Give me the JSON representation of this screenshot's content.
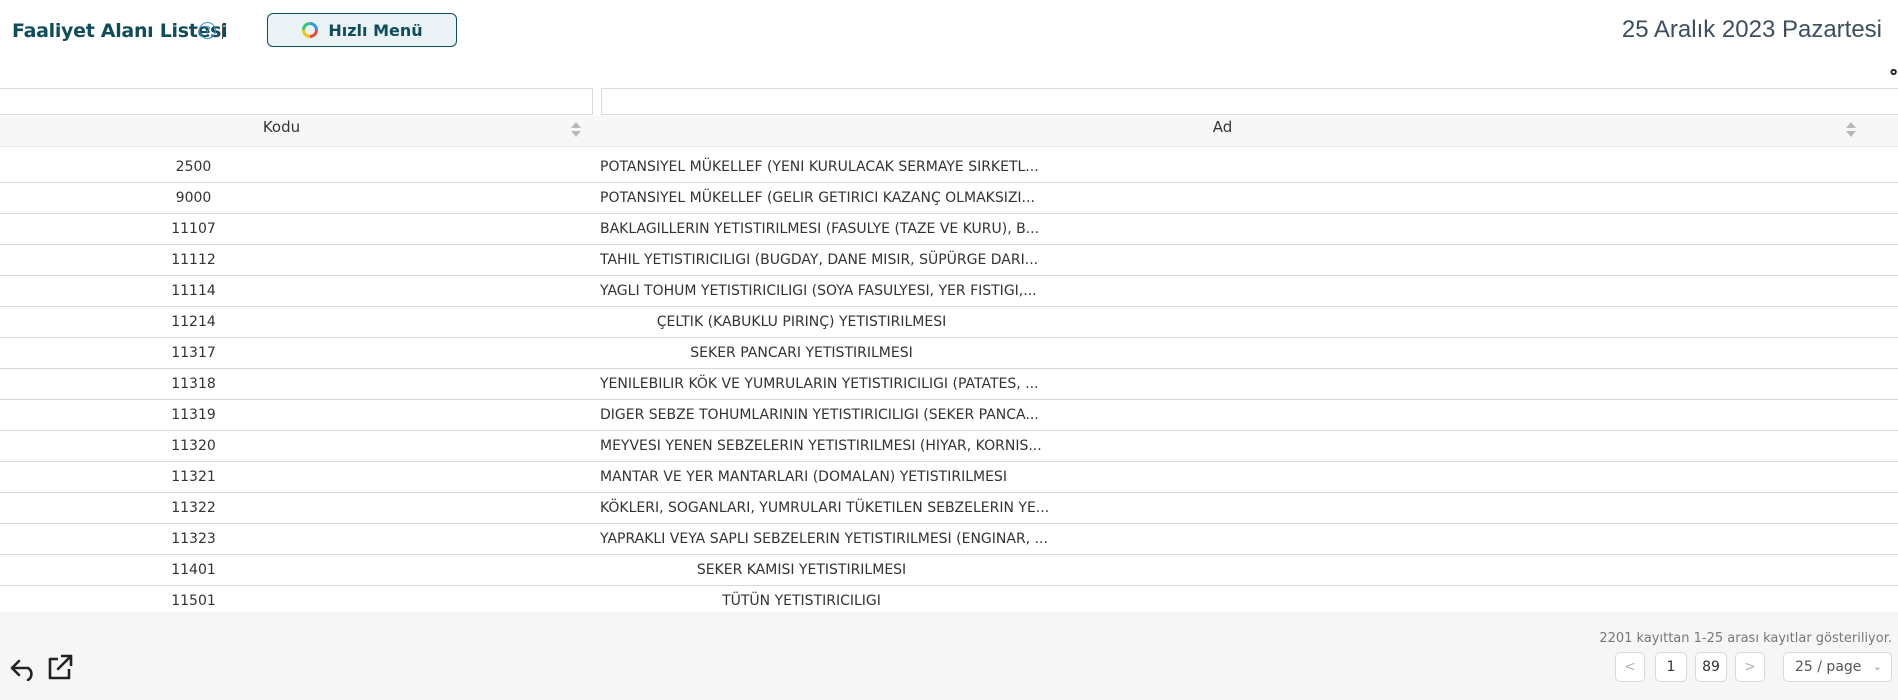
{
  "header": {
    "title": "Faaliyet Alanı Listesi",
    "help_icon": "?",
    "quick_menu_label": "Hızlı Menü",
    "date": "25 Aralık 2023 Pazartesi"
  },
  "table": {
    "columns": [
      {
        "key": "code",
        "label": "Kodu"
      },
      {
        "key": "name",
        "label": "Ad"
      }
    ],
    "rows": [
      {
        "code": "2500",
        "name": "POTANSIYEL MÜKELLEF (YENI KURULACAK SERMAYE SIRKETL..."
      },
      {
        "code": "9000",
        "name": "POTANSIYEL MÜKELLEF (GELIR GETIRICI KAZANÇ OLMAKSIZI..."
      },
      {
        "code": "11107",
        "name": "BAKLAGILLERIN YETISTIRILMESI (FASULYE (TAZE VE KURU), B..."
      },
      {
        "code": "11112",
        "name": "TAHIL YETISTIRICILIGI (BUGDAY, DANE MISIR, SÜPÜRGE DARI..."
      },
      {
        "code": "11114",
        "name": "YAGLI TOHUM YETISTIRICILIGI (SOYA FASULYESI, YER FISTIGI,..."
      },
      {
        "code": "11214",
        "name": "ÇELTIK (KABUKLU PIRINÇ) YETISTIRILMESI"
      },
      {
        "code": "11317",
        "name": "SEKER PANCARI YETISTIRILMESI"
      },
      {
        "code": "11318",
        "name": "YENILEBILIR KÖK VE YUMRULARIN YETISTIRICILIGI (PATATES, ..."
      },
      {
        "code": "11319",
        "name": "DIGER SEBZE TOHUMLARININ YETISTIRICILIGI (SEKER PANCA..."
      },
      {
        "code": "11320",
        "name": "MEYVESI YENEN SEBZELERIN YETISTIRILMESI (HIYAR, KORNIS..."
      },
      {
        "code": "11321",
        "name": "MANTAR VE YER MANTARLARI (DOMALAN) YETISTIRILMESI"
      },
      {
        "code": "11322",
        "name": "KÖKLERI, SOGANLARI, YUMRULARI TÜKETILEN SEBZELERIN YE..."
      },
      {
        "code": "11323",
        "name": "YAPRAKLI VEYA SAPLI SEBZELERIN YETISTIRILMESI (ENGINAR, ..."
      },
      {
        "code": "11401",
        "name": "SEKER KAMISI YETISTIRILMESI"
      },
      {
        "code": "11501",
        "name": "TÜTÜN YETISTIRICILIGI"
      }
    ]
  },
  "footer": {
    "record_info": "2201 kayıttan 1-25 arası kayıtlar gösteriliyor.",
    "prev": "<",
    "pages": [
      "1",
      "89"
    ],
    "next": ">",
    "page_size": "25 / page"
  },
  "icons": {
    "help": "help-icon",
    "quick_menu": "colorful-ring-icon",
    "settings": "gear-icon",
    "undo": "undo-icon",
    "export": "external-link-icon"
  },
  "colors": {
    "brand": "#0f4c5c",
    "help_blue": "#3a8dde",
    "footer_bg": "#f6f6f6"
  }
}
